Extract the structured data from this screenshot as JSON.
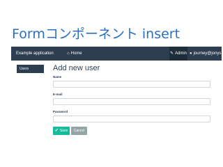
{
  "slide": {
    "title": "Formコンポーネント insert"
  },
  "navbar": {
    "brand": "Example application",
    "home_icon": "home-icon",
    "home_label": "Home",
    "admin_icon": "wrench-icon",
    "admin_label": "Admin",
    "user_icon": "user-icon",
    "user_label": "journey@jonys.net"
  },
  "sidebar": {
    "items": [
      {
        "label": "Users"
      }
    ]
  },
  "main": {
    "heading": "Add new user",
    "fields": [
      {
        "label": "Name",
        "value": ""
      },
      {
        "label": "E-mail",
        "value": ""
      },
      {
        "label": "Password",
        "value": ""
      }
    ],
    "save_icon": "check-icon",
    "save_label": "Save",
    "cancel_label": "Cancel"
  },
  "colors": {
    "title": "#2a6fc1",
    "navbar": "#2c3e50",
    "accent": "#18bc9c",
    "cancel": "#95a5a6"
  }
}
